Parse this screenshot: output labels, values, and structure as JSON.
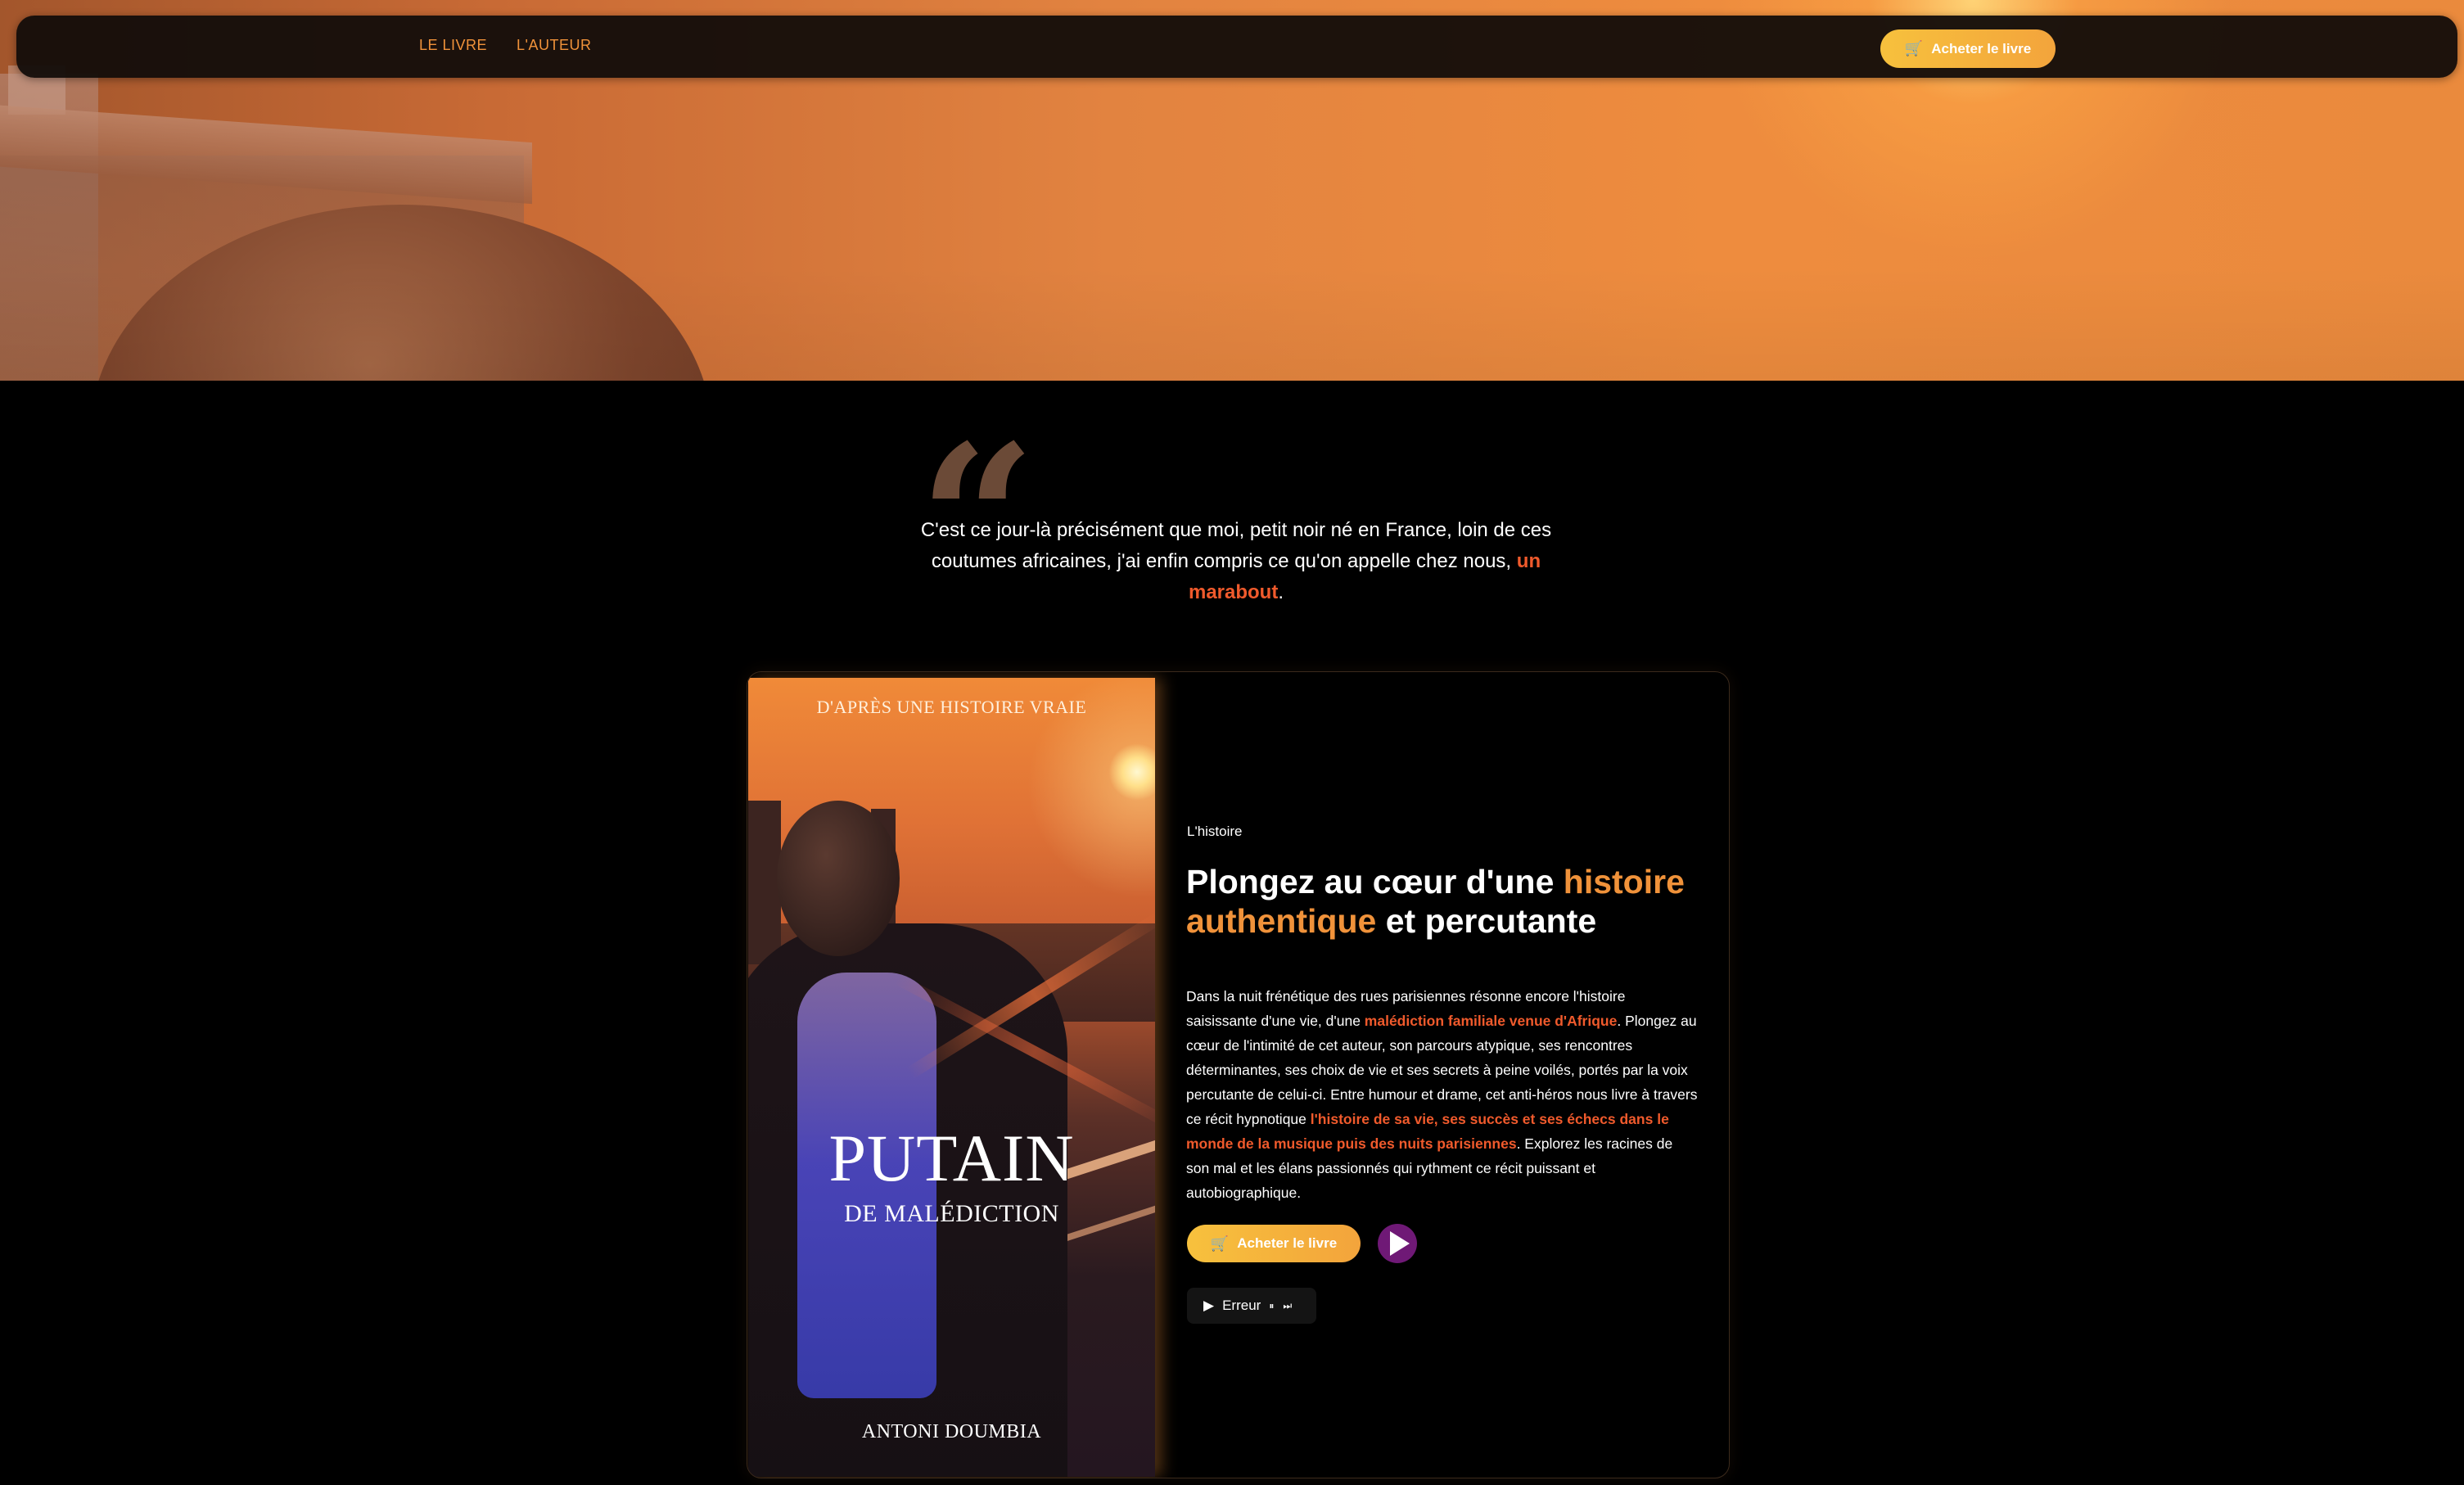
{
  "nav": {
    "links": [
      "LE LIVRE",
      "L'AUTEUR"
    ],
    "buy_label": "Acheter le livre"
  },
  "quote": {
    "text": "C'est ce jour-là précisément que moi, petit noir né en France, loin de ces coutumes africaines, j'ai enfin compris ce qu'on appelle chez nous,",
    "highlight": "un marabout",
    "end": "."
  },
  "book": {
    "cover": {
      "top": "D'APRÈS UNE HISTOIRE VRAIE",
      "title": "PUTAIN",
      "subtitle": "DE MALÉDICTION",
      "author": "ANTONI DOUMBIA"
    },
    "eyebrow": "L'histoire",
    "heading": {
      "part1": "Plongez au cœur d'une ",
      "highlight": "histoire authentique",
      "part2": " et percutante"
    },
    "desc": {
      "p1": "Dans la nuit frénétique des rues parisiennes résonne encore l'histoire saisissante d'une vie, d'une ",
      "h1": "malédiction familiale venue d'Afrique",
      "p2": ". Plongez au cœur de l'intimité de cet auteur, son parcours atypique, ses rencontres déterminantes, ses choix de vie et ses secrets à peine voilés, portés par la voix percutante de celui-ci. Entre humour et drame, cet anti-héros nous livre à travers ce récit hypnotique ",
      "h2": "l'histoire de sa vie, ses succès et ses échecs dans le monde de la musique puis des nuits parisiennes",
      "p3": ". Explorez les racines de son mal et les élans passionnés qui rythment ce récit puissant et autobiographique."
    },
    "buy_label": "Acheter le livre",
    "audio": {
      "play_glyph": "▶",
      "status": "Erreur",
      "pause_glyph": "⏸",
      "skip_glyph": "⏭"
    }
  },
  "colors": {
    "accent": "#f0923a",
    "highlight": "#f05a2c",
    "button_start": "#f7c13d",
    "button_end": "#f3a43c",
    "play_button": "#6f1976"
  },
  "icons": [
    "cart-icon",
    "play-icon",
    "pause-icon",
    "skip-icon"
  ]
}
